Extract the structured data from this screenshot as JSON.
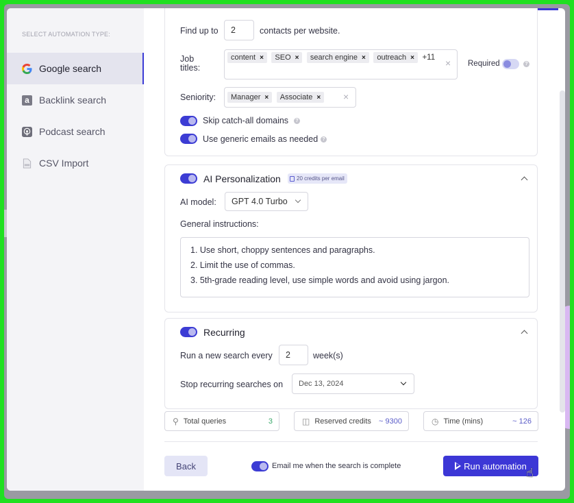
{
  "sidebar": {
    "title": "SELECT AUTOMATION TYPE:",
    "items": [
      {
        "label": "Google search",
        "icon": "google-icon"
      },
      {
        "label": "Backlink search",
        "icon": "backlink-icon"
      },
      {
        "label": "Podcast search",
        "icon": "podcast-icon"
      },
      {
        "label": "CSV Import",
        "icon": "csv-file-icon"
      }
    ]
  },
  "contacts": {
    "find_label": "Find up to",
    "find_value": "2",
    "per_website_label": "contacts per website.",
    "job_titles_label": "Job titles:",
    "job_titles": [
      "content",
      "SEO",
      "search engine",
      "outreach"
    ],
    "job_titles_more": "+11",
    "required_label": "Required",
    "seniority_label": "Seniority:",
    "seniority": [
      "Manager",
      "Associate"
    ],
    "skip_catch_all_label": "Skip catch-all domains",
    "generic_emails_label": "Use generic emails as needed"
  },
  "ai": {
    "title": "AI Personalization",
    "credits_badge": "20 credits per email",
    "model_label": "AI model:",
    "model_value": "GPT 4.0 Turbo",
    "instructions_label": "General instructions:",
    "instructions": [
      "1. Use short, choppy sentences and paragraphs.",
      "2. Limit the use of commas.",
      "3. 5th-grade reading level, use simple words and avoid using jargon."
    ]
  },
  "recurring": {
    "title": "Recurring",
    "run_every_label": "Run a new search every",
    "run_every_value": "2",
    "unit_label": "week(s)",
    "stop_label": "Stop recurring searches on",
    "stop_date": "Dec 13, 2024"
  },
  "stats": {
    "total_queries_label": "Total queries",
    "total_queries_value": "3",
    "reserved_credits_label": "Reserved credits",
    "reserved_credits_value": "~ 9300",
    "time_label": "Time (mins)",
    "time_value": "~ 126"
  },
  "footer": {
    "back_label": "Back",
    "email_me_label": "Email me when the search is complete",
    "run_label": "Run automation"
  },
  "colors": {
    "accent": "#3c37d6",
    "toggle_knob": "#b9b9f0",
    "sidebar_bg": "#f4f4f7",
    "frame_green": "#20e020"
  }
}
